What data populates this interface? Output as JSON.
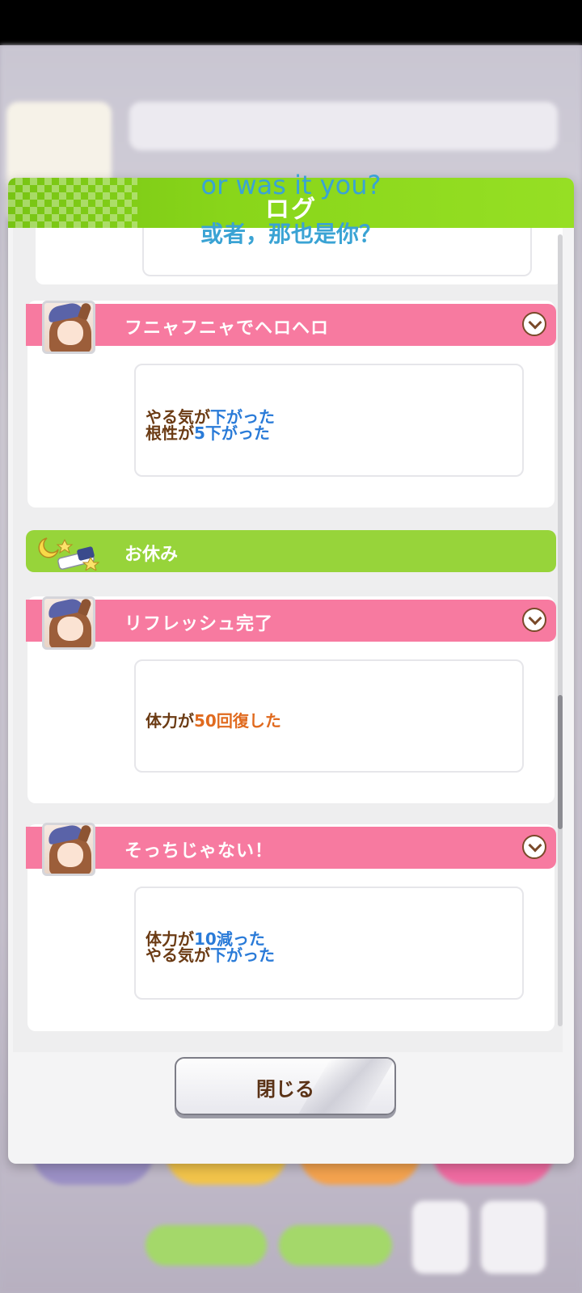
{
  "subtitles": {
    "english": "or was it you?",
    "chinese": "或者，那也是你？"
  },
  "dialog": {
    "title": "ログ",
    "close_label": "閉じる"
  },
  "log_entries": [
    {
      "title": "フニャフニャでヘロヘロ",
      "lines": [
        [
          {
            "text": "やる気が",
            "color": "brown"
          },
          {
            "text": "下がった",
            "color": "blue"
          }
        ],
        [
          {
            "text": "根性が",
            "color": "brown"
          },
          {
            "text": "5下がった",
            "color": "blue"
          }
        ]
      ]
    },
    {
      "section_title": "お休み"
    },
    {
      "title": "リフレッシュ完了",
      "lines": [
        [
          {
            "text": "体力が",
            "color": "brown"
          },
          {
            "text": "50回復した",
            "color": "orange"
          }
        ]
      ]
    },
    {
      "title": "そっちじゃない！",
      "lines": [
        [
          {
            "text": "体力が",
            "color": "brown"
          },
          {
            "text": "10減った",
            "color": "blue"
          }
        ],
        [
          {
            "text": "やる気が",
            "color": "brown"
          },
          {
            "text": "下がった",
            "color": "blue"
          }
        ]
      ]
    }
  ],
  "colors": {
    "header_green": "#89d61a",
    "event_pink": "#f77aa0",
    "rest_green": "#97d43a",
    "text_brown": "#6b3b14",
    "value_blue": "#2a7bd8",
    "value_orange": "#e06a1e",
    "subtitle_blue": "#3aa3d4"
  }
}
